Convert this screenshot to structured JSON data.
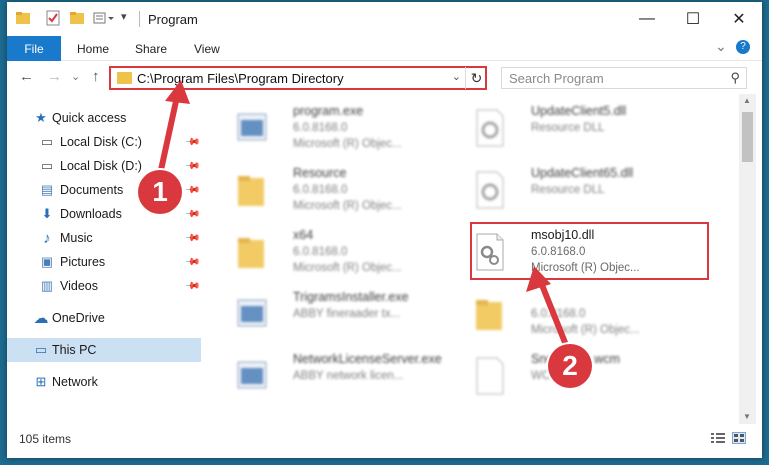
{
  "window": {
    "title": "Program",
    "controls": {
      "minimize": "—",
      "maximize": "☐",
      "close": "✕"
    }
  },
  "ribbon": {
    "file_tab": "File",
    "tabs": [
      "Home",
      "Share",
      "View"
    ],
    "expand_glyph": "⌄",
    "help_glyph": "?"
  },
  "nav": {
    "back": "←",
    "forward": "→",
    "recent": "⌄",
    "up": "↑",
    "address": "C:\\Program Files\\Program Directory",
    "address_chevron": "⌄",
    "refresh": "↻",
    "search_placeholder": "Search Program",
    "search_glyph": "⚲"
  },
  "sidebar": {
    "items": [
      {
        "label": "Quick access",
        "icon": "star-icon",
        "glyph": "★",
        "pinned": false
      },
      {
        "label": "Local Disk (C:)",
        "icon": "drive-icon",
        "glyph": "▭",
        "pinned": true
      },
      {
        "label": "Local Disk (D:)",
        "icon": "drive-icon",
        "glyph": "▭",
        "pinned": true
      },
      {
        "label": "Documents",
        "icon": "documents-icon",
        "glyph": "▤",
        "pinned": true
      },
      {
        "label": "Downloads",
        "icon": "downloads-icon",
        "glyph": "⬇",
        "pinned": true
      },
      {
        "label": "Music",
        "icon": "music-icon",
        "glyph": "♪",
        "pinned": true
      },
      {
        "label": "Pictures",
        "icon": "pictures-icon",
        "glyph": "▣",
        "pinned": true
      },
      {
        "label": "Videos",
        "icon": "videos-icon",
        "glyph": "▥",
        "pinned": true
      },
      {
        "label": "OneDrive",
        "icon": "cloud-icon",
        "glyph": "☁",
        "pinned": false
      },
      {
        "label": "This PC",
        "icon": "computer-icon",
        "glyph": "▭",
        "pinned": false
      },
      {
        "label": "Network",
        "icon": "network-icon",
        "glyph": "⊞",
        "pinned": false
      }
    ],
    "pin_glyph": "📌"
  },
  "files": [
    {
      "name": "program.exe",
      "desc1": "6.0.8168.0",
      "desc2": "Microsoft (R) Objec...",
      "icon": "exe-icon"
    },
    {
      "name": "UpdateClient5.dll",
      "desc1": "Resource DLL",
      "desc2": "",
      "icon": "dll-icon"
    },
    {
      "name": "Resource",
      "desc1": "6.0.8168.0",
      "desc2": "Microsoft (R) Objec...",
      "icon": "folder-icon"
    },
    {
      "name": "UpdateClient65.dll",
      "desc1": "Resource DLL",
      "desc2": "",
      "icon": "dll-icon"
    },
    {
      "name": "x64",
      "desc1": "6.0.8168.0",
      "desc2": "Microsoft (R) Objec...",
      "icon": "folder-icon"
    },
    {
      "name": "msobj10.dll",
      "desc1": "6.0.8168.0",
      "desc2": "Microsoft (R) Objec...",
      "icon": "dll-icon"
    },
    {
      "name": "TrigramsInstaller.exe",
      "desc1": "ABBY fineraader tx...",
      "desc2": "",
      "icon": "exe-icon"
    },
    {
      "name": "",
      "desc1": "6.0.8168.0",
      "desc2": "Microsoft (R) Objec...",
      "icon": "folder-icon"
    },
    {
      "name": "NetworkLicenseServer.exe",
      "desc1": "ABBY network licen...",
      "desc2": "",
      "icon": "exe-icon"
    },
    {
      "name": "SndToDB5.wcm",
      "desc1": "WCM File",
      "desc2": "",
      "icon": "file-icon"
    }
  ],
  "status": {
    "items_count": "105 items"
  },
  "callouts": [
    "1",
    "2"
  ],
  "colors": {
    "accent": "#1979ca",
    "highlight_red": "#d9393e",
    "selected_bg": "#cce0f3"
  }
}
